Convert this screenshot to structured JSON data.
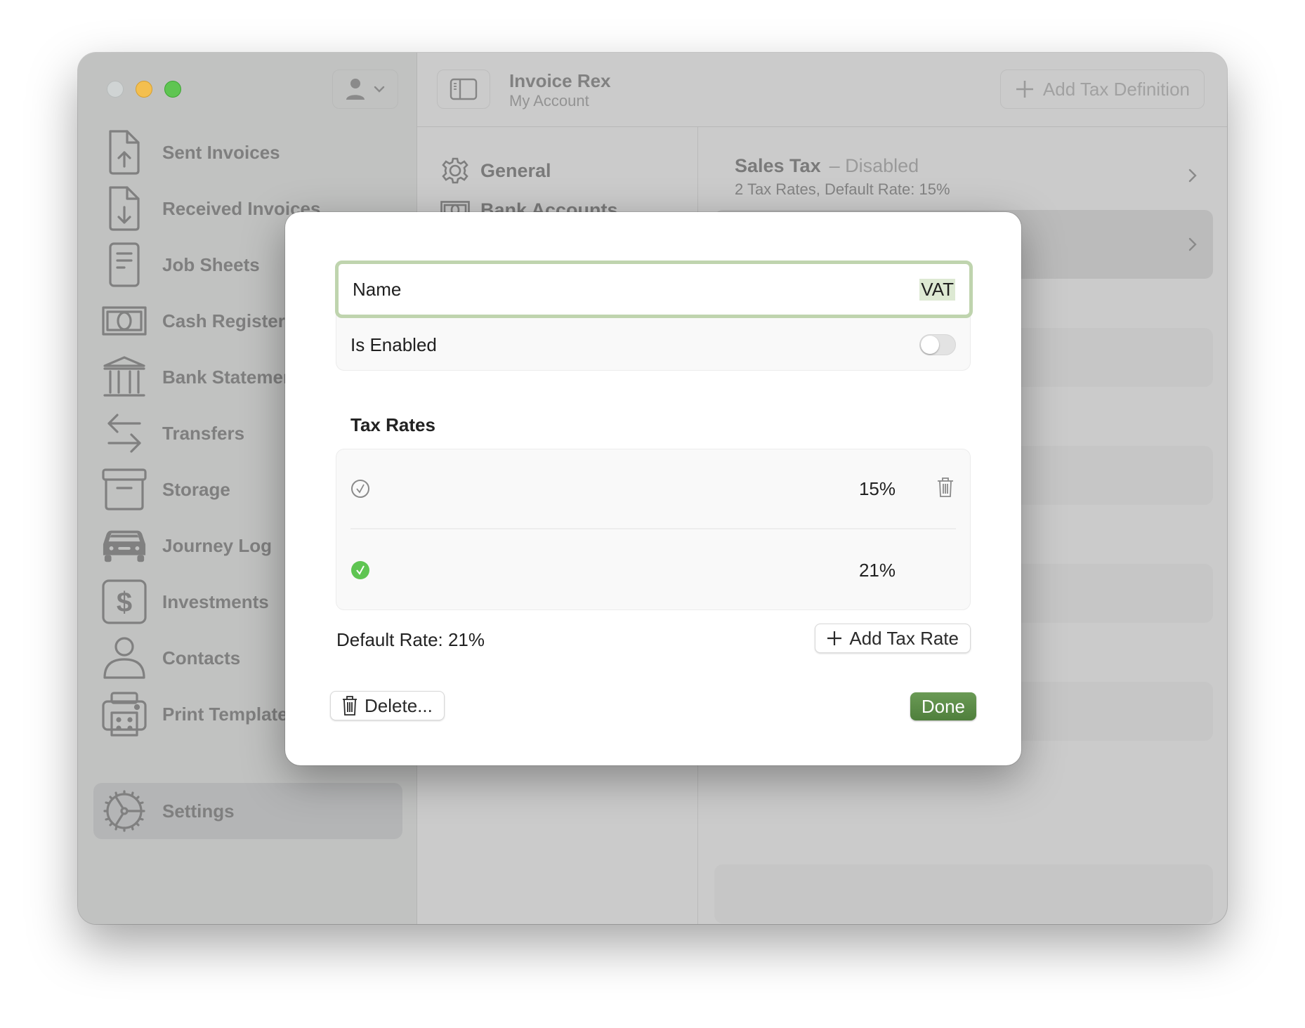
{
  "window": {
    "traffic_lights": [
      "close",
      "minimize",
      "maximize"
    ]
  },
  "sidebar": {
    "account_icon": "person-icon",
    "items": [
      {
        "label": "Sent Invoices",
        "icon": "doc-arrow-up-icon"
      },
      {
        "label": "Received Invoices",
        "icon": "doc-arrow-down-icon"
      },
      {
        "label": "Job Sheets",
        "icon": "doc-lines-icon"
      },
      {
        "label": "Cash Register",
        "icon": "banknote-icon"
      },
      {
        "label": "Bank Statements",
        "icon": "bank-icon"
      },
      {
        "label": "Transfers",
        "icon": "arrows-left-right-icon"
      },
      {
        "label": "Storage",
        "icon": "archivebox-icon"
      },
      {
        "label": "Journey Log",
        "icon": "car-icon"
      },
      {
        "label": "Investments",
        "icon": "dollar-square-icon"
      },
      {
        "label": "Contacts",
        "icon": "person-outline-icon"
      },
      {
        "label": "Print Templates",
        "icon": "printer-icon"
      }
    ],
    "settings": {
      "label": "Settings",
      "icon": "gear-wheel-icon",
      "selected": true
    }
  },
  "toolbar": {
    "title": "Invoice Rex",
    "subtitle": "My Account",
    "add_tax_definition": "Add Tax Definition"
  },
  "settings_nav": [
    {
      "label": "General",
      "icon": "gear-icon"
    },
    {
      "label": "Bank Accounts",
      "icon": "banknote-icon"
    }
  ],
  "tax_definitions": [
    {
      "name": "Sales Tax",
      "status": "– Disabled",
      "summary": "2 Tax Rates, Default Rate: 15%"
    }
  ],
  "modal": {
    "name_label": "Name",
    "name_value": "VAT",
    "enabled_label": "Is Enabled",
    "enabled": false,
    "tax_rates_title": "Tax Rates",
    "rates": [
      {
        "value": "15%",
        "is_default": false,
        "deletable": true
      },
      {
        "value": "21%",
        "is_default": true,
        "deletable": false
      }
    ],
    "default_rate_text": "Default Rate: 21%",
    "add_tax_rate": "Add Tax Rate",
    "delete": "Delete...",
    "done": "Done"
  },
  "colors": {
    "accent_green": "#5a8a45",
    "focus_ring": "#bfd4ae",
    "default_check": "#5fc552"
  }
}
